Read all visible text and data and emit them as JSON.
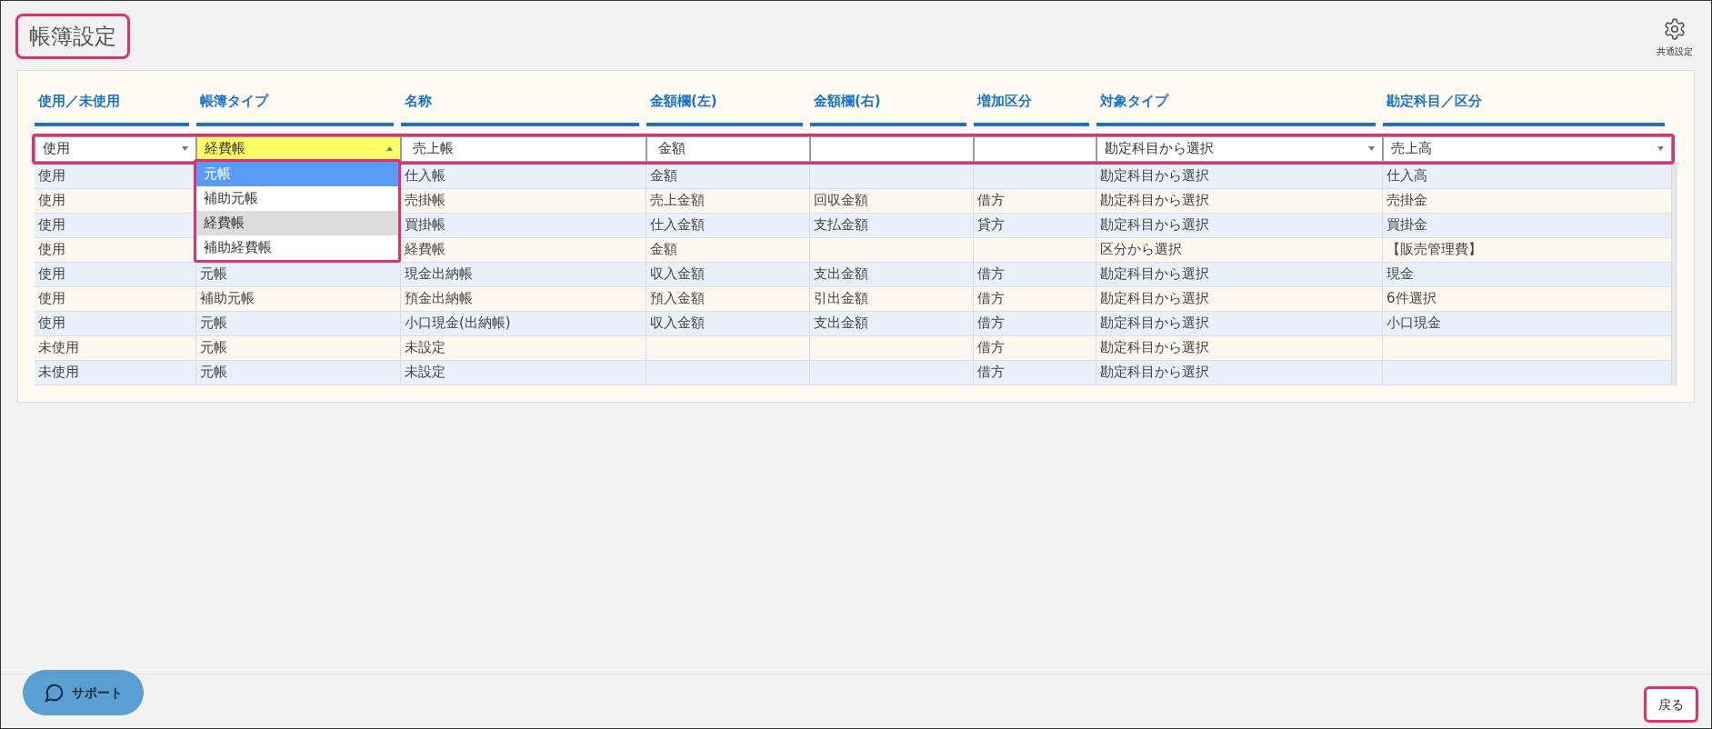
{
  "title": "帳簿設定",
  "settings_button": {
    "label": "共通設定"
  },
  "table": {
    "columns": [
      "使用／未使用",
      "帳簿タイプ",
      "名称",
      "金額欄(左)",
      "金額欄(右)",
      "増加区分",
      "対象タイプ",
      "勘定科目／区分"
    ],
    "edit_row": [
      {
        "kind": "select",
        "value": "使用",
        "focused": false
      },
      {
        "kind": "select",
        "value": "経費帳",
        "focused": true
      },
      {
        "kind": "text",
        "value": "売上帳"
      },
      {
        "kind": "text",
        "value": "金額"
      },
      {
        "kind": "text"
      },
      {
        "kind": "text"
      },
      {
        "kind": "select",
        "value": "勘定科目から選択",
        "focused": false
      },
      {
        "kind": "select",
        "value": "売上高",
        "focused": false
      }
    ],
    "dropdown": {
      "options": [
        {
          "label": "元帳",
          "selected": true,
          "current": false
        },
        {
          "label": "補助元帳",
          "selected": false,
          "current": false
        },
        {
          "label": "経費帳",
          "selected": false,
          "current": true
        },
        {
          "label": "補助経費帳",
          "selected": false,
          "current": false
        }
      ]
    },
    "rows": [
      {
        "usage": "使用",
        "name": "仕入帳",
        "amount_left": "金額",
        "target_type": "勘定科目から選択",
        "account": "仕入高"
      },
      {
        "usage": "使用",
        "name": "売掛帳",
        "amount_left": "売上金額",
        "amount_right": "回収金額",
        "increase": "借方",
        "target_type": "勘定科目から選択",
        "account": "売掛金"
      },
      {
        "usage": "使用",
        "name": "買掛帳",
        "amount_left": "仕入金額",
        "amount_right": "支払金額",
        "increase": "貸方",
        "target_type": "勘定科目から選択",
        "account": "買掛金"
      },
      {
        "usage": "使用",
        "name": "経費帳",
        "amount_left": "金額",
        "target_type": "区分から選択",
        "account": "【販売管理費】"
      },
      {
        "usage": "使用",
        "book_type": "元帳",
        "name": "現金出納帳",
        "amount_left": "収入金額",
        "amount_right": "支出金額",
        "increase": "借方",
        "target_type": "勘定科目から選択",
        "account": "現金"
      },
      {
        "usage": "使用",
        "book_type": "補助元帳",
        "name": "預金出納帳",
        "amount_left": "預入金額",
        "amount_right": "引出金額",
        "increase": "借方",
        "target_type": "勘定科目から選択",
        "account": "6件選択"
      },
      {
        "usage": "使用",
        "book_type": "元帳",
        "name": "小口現金(出納帳)",
        "amount_left": "収入金額",
        "amount_right": "支出金額",
        "increase": "借方",
        "target_type": "勘定科目から選択",
        "account": "小口現金"
      },
      {
        "usage": "未使用",
        "book_type": "元帳",
        "name": "未設定",
        "increase": "借方",
        "target_type": "勘定科目から選択"
      },
      {
        "usage": "未使用",
        "book_type": "元帳",
        "name": "未設定",
        "increase": "借方",
        "target_type": "勘定科目から選択"
      }
    ]
  },
  "support_button": {
    "label": "サポート"
  },
  "back_button": {
    "label": "戻る"
  }
}
